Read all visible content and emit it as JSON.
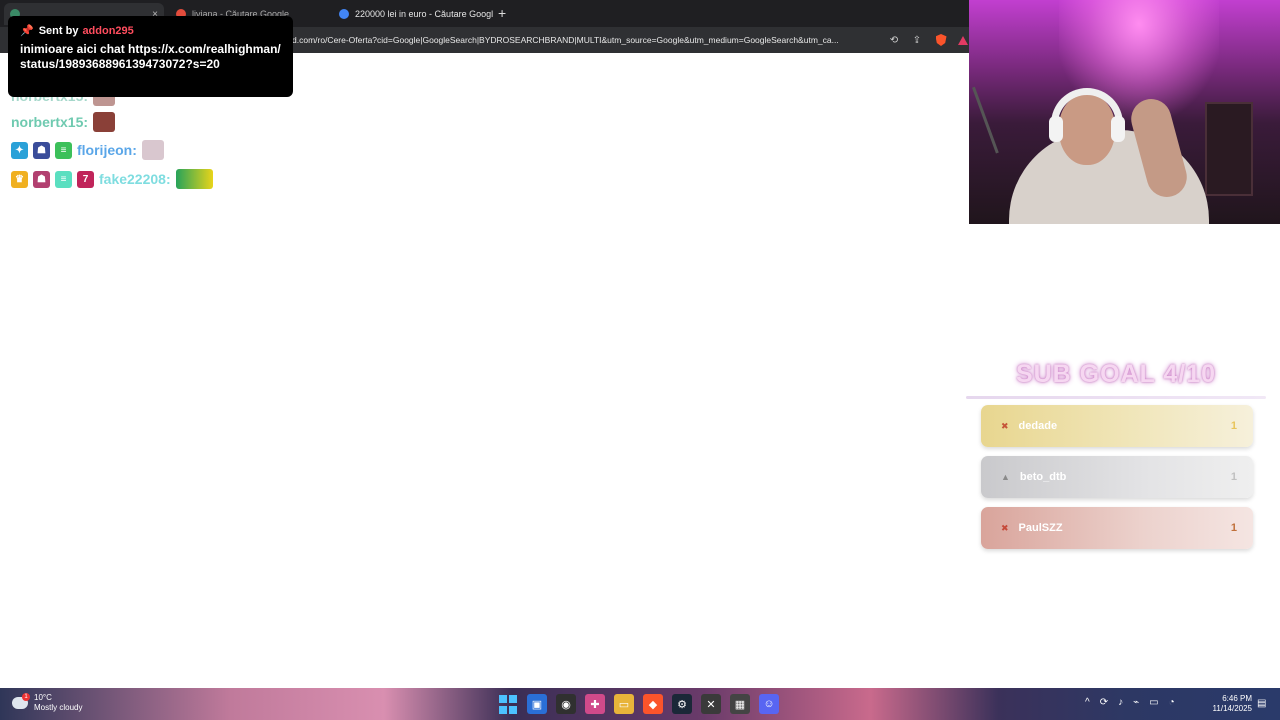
{
  "browser": {
    "tabs": [
      {
        "label": "",
        "active": true,
        "favicon_color": "#3a8a66"
      },
      {
        "label": "livianа - Căutare Google",
        "active": false,
        "favicon_color": "#e34c3c"
      },
      {
        "label": "220000 lei in euro - Căutare Google",
        "active": false,
        "favicon_color": "#4285f4"
      }
    ],
    "close_glyph": "×",
    "newtab_glyph": "+",
    "url": "d.com/ro/Cere-Oferta?cid=Google|GoogleSearch|BYDROSEARCHBRAND|MULTI&utm_source=Google&utm_medium=GoogleSearch&utm_ca..."
  },
  "alert": {
    "prefix": "Sent by",
    "sender": "addon295",
    "message": "inimioare aici chat https://x.com/realhighman/status/1989368896139473072?s=20"
  },
  "chat": [
    {
      "name": "norbertx15:",
      "color": "#5db8a0"
    },
    {
      "name": "norbertx15:",
      "color": "#6fcab0"
    },
    {
      "name": "florijeon:",
      "color": "#5aa6e8"
    },
    {
      "name": "fake22208:",
      "color": "#7fdde0"
    }
  ],
  "sub_goal": {
    "title": "SUB GOAL 4/10",
    "progress": 0.4,
    "entries": [
      {
        "name": "dedade",
        "count": "1",
        "icon_color": "#c6553a",
        "count_color": "#e8c45a"
      },
      {
        "name": "beto_dtb",
        "count": "1",
        "icon_color": "#8a8a8a",
        "count_color": "#c0c0c0"
      },
      {
        "name": "PaulSZZ",
        "count": "1",
        "icon_color": "#c64a3a",
        "count_color": "#c0703a"
      }
    ]
  },
  "taskbar": {
    "temperature": "10°C",
    "weather": "Mostly cloudy",
    "weather_badge": "1",
    "time": "6:46 PM",
    "date": "11/14/2025"
  },
  "colors": {
    "accent": "#ff4d5e",
    "webcam_glow": "#c23fd0"
  }
}
